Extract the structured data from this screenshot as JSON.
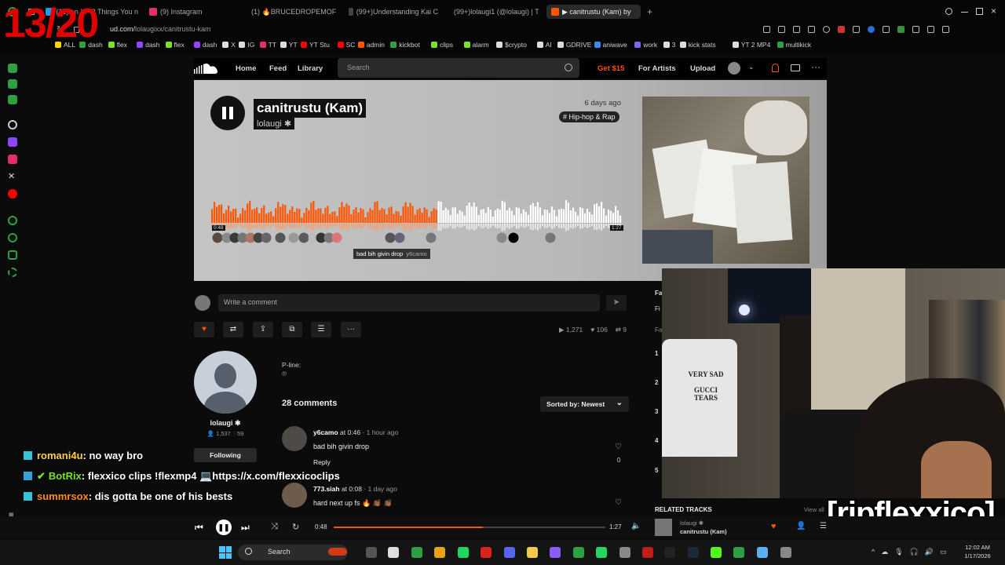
{
  "overlay": {
    "counter": "13/20",
    "stream_tag": "[ripflexxico]"
  },
  "browser": {
    "tabs": [
      {
        "label": "(12) on X: \"2 Things You n",
        "color": "#1d9bf0"
      },
      {
        "label": "(9) Instagram",
        "color": "#e1306c"
      },
      {
        "label": "(1) 🔥BRUCEDROPEMOFF",
        "color": "#ff0000"
      },
      {
        "label": "(99+)Understanding Kai C",
        "color": "#111111"
      },
      {
        "label": "(99+)lolaugi1 (@lolaugi) | T",
        "color": "#111111"
      },
      {
        "label": "▶ canitrustu (Kam) by",
        "color": "#ff5500"
      }
    ],
    "url": "soundcloud.com/lolaugixx/canitrustu-kam",
    "url_prefix": "ud.com/",
    "url_path": "lolaugixx/canitrustu-kam",
    "bookmarks": [
      "ALL",
      "dash",
      "flex",
      "dash",
      "flex",
      "dash",
      "X",
      "IG",
      "TT",
      "YT",
      "YT Stu",
      "SC",
      "admin",
      "kickbot",
      "clips",
      "alarm",
      "$crypto",
      "AI",
      "GDRIVE",
      "aniwave",
      "work",
      "3",
      "kick stats",
      "YT 2 MP4",
      "multikick"
    ]
  },
  "sc_nav": {
    "home": "Home",
    "feed": "Feed",
    "library": "Library",
    "search_placeholder": "Search",
    "get15": "Get $15",
    "for_artists": "For Artists",
    "upload": "Upload"
  },
  "track": {
    "title": "canitrustu (Kam)",
    "artist": "lolaugi ✱",
    "ago": "6 days ago",
    "genre": "# Hip-hop & Rap",
    "elapsed": "0:48",
    "duration": "1:27",
    "progress": 0.55,
    "tooltip_comment": "bad bih givin drop",
    "tooltip_user": "y6camo",
    "plays": "1,271",
    "likes": "106",
    "reposts": "9",
    "pline_label": "P-line:",
    "pline_symbol": "℗"
  },
  "comment_input": {
    "placeholder": "Write a comment"
  },
  "uploader": {
    "name": "lolaugi ✱",
    "followers": "1,537",
    "tracks": "59",
    "follow_label": "Following"
  },
  "comments": {
    "count_label": "28 comments",
    "sort_label": "Sorted by: Newest",
    "items": [
      {
        "user": "y6camo",
        "at": "at 0:46",
        "when": "· 1 hour ago",
        "text": "bad bih givin drop",
        "reply": "Reply",
        "likes": "0"
      },
      {
        "user": "773.siah",
        "at": "at 0:08",
        "when": "· 1 day ago",
        "text": "hard next up fs 🔥 👏🏾 👏🏾",
        "reply": "",
        "likes": ""
      }
    ]
  },
  "related": {
    "header": "RELATED TRACKS",
    "view_all": "View all",
    "item_artist": "lolaugi ✱",
    "item_title": "canitrustu (Kam)"
  },
  "right_list": {
    "letters": [
      "Fa",
      "Fi",
      "Fa"
    ],
    "numbers": [
      "1",
      "2",
      "3",
      "4",
      "5"
    ]
  },
  "webcam_shirt": [
    "VERY SAD",
    "GUCCI TEARS"
  ],
  "chat": [
    {
      "user": "romani4u",
      "color": "#ffd04a",
      "message": ": no way bro",
      "badge": "#37c2d8"
    },
    {
      "user": "BotRix",
      "color": "#7be22a",
      "message": ": flexxico clips !flexmp4 💻https://x.com/flexxicoclips",
      "badge": "#37a0d8"
    },
    {
      "user": "summrsox",
      "color": "#ff8c1a",
      "message": ": dis gotta be one of his bests",
      "badge": "#37c2d8"
    }
  ],
  "player": {
    "elapsed": "0:48",
    "duration": "1:27",
    "progress": 0.55
  },
  "taskbar": {
    "search": "Search",
    "time": "12:02 AM",
    "date": "1/17/2026"
  },
  "colors": {
    "accent": "#ff5500",
    "red_overlay": "#e10000"
  }
}
